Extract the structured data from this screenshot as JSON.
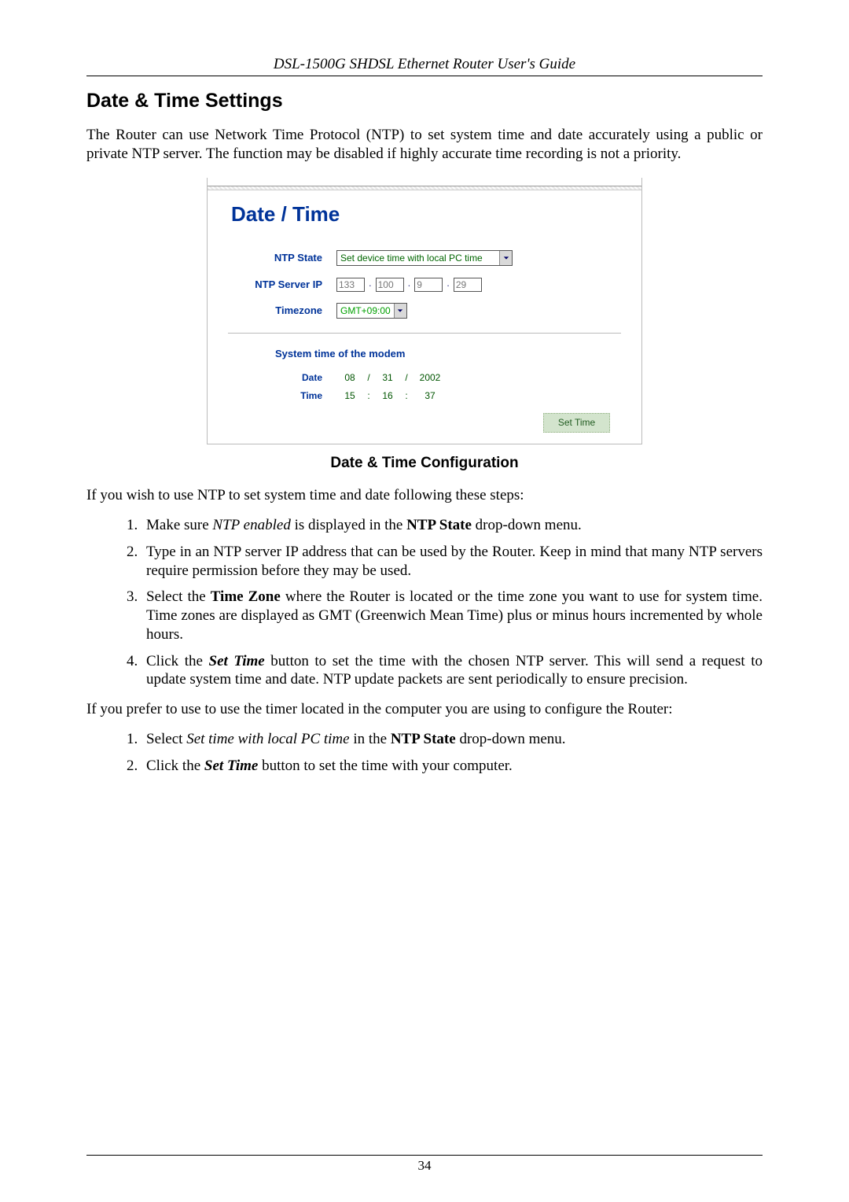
{
  "header": {
    "running_head": "DSL-1500G SHDSL Ethernet Router User's Guide"
  },
  "section": {
    "title": "Date & Time Settings",
    "intro": "The Router can use Network Time Protocol (NTP) to set system time and date accurately using a public or private NTP server. The function may be disabled if highly accurate time recording is not a priority."
  },
  "figure": {
    "title": "Date / Time",
    "labels": {
      "ntp_state": "NTP State",
      "ntp_server_ip": "NTP Server IP",
      "timezone": "Timezone",
      "system_time_heading": "System time of the modem",
      "date": "Date",
      "time": "Time"
    },
    "values": {
      "ntp_state_selected": "Set device time with local PC time",
      "ip_octets": [
        "133",
        "100",
        "9",
        "29"
      ],
      "timezone_selected": "GMT+09:00",
      "date_parts": {
        "mm": "08",
        "dd": "31",
        "yyyy": "2002"
      },
      "time_parts": {
        "hh": "15",
        "mm": "16",
        "ss": "37"
      },
      "date_sep": "/",
      "time_sep": ":"
    },
    "buttons": {
      "set_time": "Set Time"
    },
    "caption": "Date & Time Configuration"
  },
  "instructions": {
    "ntp_intro": "If you wish to use NTP to set system time and date following these steps:",
    "ntp_steps": [
      {
        "pre": "Make sure ",
        "em": "NTP enabled",
        "post1": " is displayed in the ",
        "b": "NTP State",
        "post2": " drop-down menu."
      },
      {
        "text": "Type in an NTP server IP address that can be used by the Router. Keep in mind that many NTP servers require permission before they may be used."
      },
      {
        "pre": "Select the ",
        "b": "Time Zone",
        "post": " where the Router is located or the time zone you want to use for system time. Time zones are displayed as GMT (Greenwich Mean Time) plus or minus hours incremented by whole hours."
      },
      {
        "pre": "Click the ",
        "bi": "Set Time",
        "post": " button to set the time with the chosen NTP server. This will send a request to update system time and date. NTP update packets are sent periodically to ensure precision."
      }
    ],
    "pc_intro": "If you prefer to use to use the timer located in the computer you are using to configure the Router:",
    "pc_steps": [
      {
        "pre": "Select ",
        "em": "Set time with local PC time",
        "post1": " in the ",
        "b": "NTP State",
        "post2": " drop-down menu."
      },
      {
        "pre": "Click the ",
        "bi": "Set Time",
        "post": " button to set the time with your computer."
      }
    ]
  },
  "footer": {
    "page_number": "34"
  }
}
